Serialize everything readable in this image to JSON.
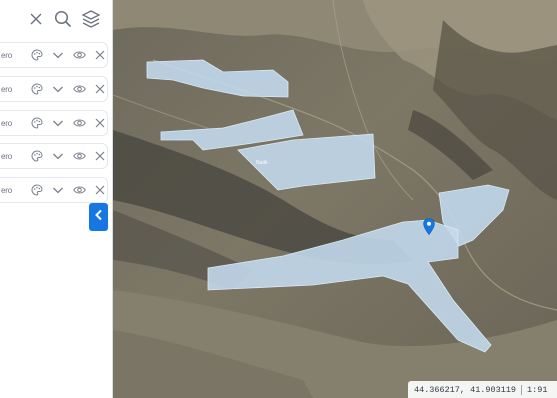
{
  "panel": {
    "toolbar": {
      "close_icon": "close-icon",
      "search_icon": "search-icon",
      "layers_icon": "layers-icon"
    },
    "layers": [
      {
        "name": "ero"
      },
      {
        "name": "ero"
      },
      {
        "name": "ero"
      },
      {
        "name": "ero"
      },
      {
        "name": "ero"
      }
    ],
    "collapse_icon": "chevron-left-icon"
  },
  "map": {
    "polygon_label": "Nurik",
    "coordinates": "44.366217, 41.903119",
    "scale": "1:91"
  },
  "colors": {
    "accent": "#1677e3",
    "polygon_fill": "#c3dbef",
    "terrain_dark": "#4c4a42",
    "terrain_light": "#a8a08a"
  }
}
